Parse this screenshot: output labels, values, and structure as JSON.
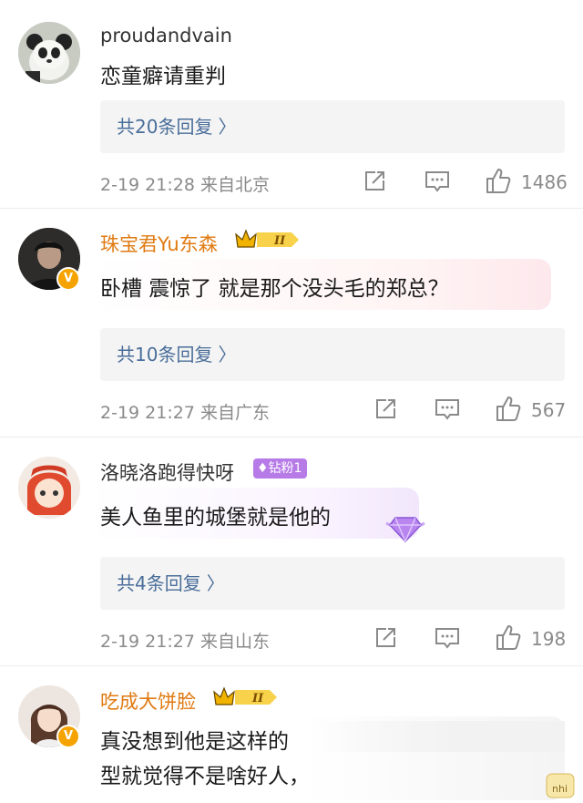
{
  "comments": [
    {
      "username": "proudandvain",
      "text": "恋童癖请重判",
      "replies_label": "共20条回复",
      "meta": "2-19 21:28 来自北京",
      "likes": "1486"
    },
    {
      "username": "珠宝君Yu东森",
      "badge": "II",
      "text": "卧槽 震惊了 就是那个没头毛的郑总？",
      "replies_label": "共10条回复",
      "meta": "2-19 21:27 来自广东",
      "likes": "567"
    },
    {
      "username": "洛晓洛跑得快呀",
      "fan_badge": "钻粉1",
      "text": "美人鱼里的城堡就是他的",
      "replies_label": "共4条回复",
      "meta": "2-19 21:27 来自山东",
      "likes": "198"
    },
    {
      "username": "吃成大饼脸",
      "badge": "II",
      "text_line1": "真没想到他是这样的",
      "text_line2": "型就觉得不是啥好人，"
    }
  ],
  "colors": {
    "reply_link": "#4a6e9a",
    "gold_name": "#e07a12",
    "meta_gray": "#8a8a8a",
    "reply_bg": "#f4f4f4"
  }
}
